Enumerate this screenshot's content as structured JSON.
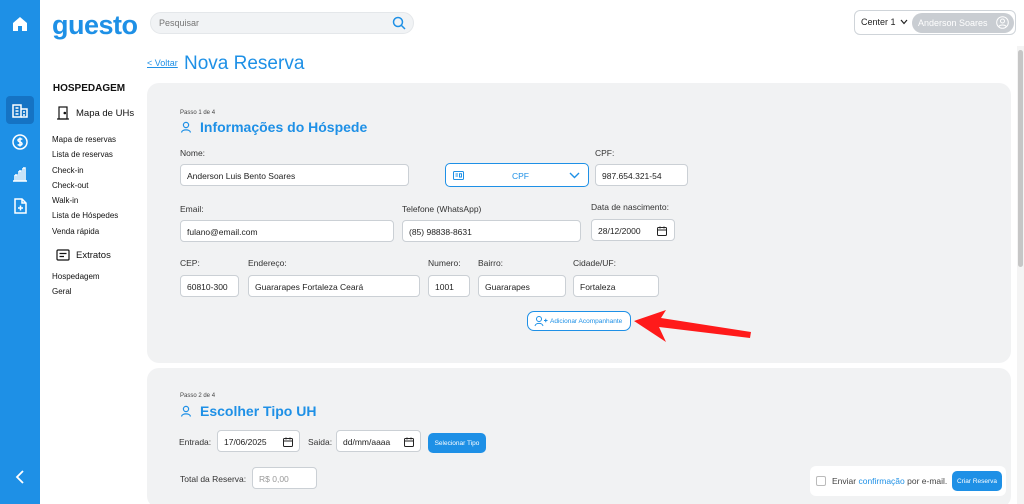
{
  "brand": {
    "logo_text": "guesto",
    "accent": "#1e90e6"
  },
  "search": {
    "placeholder": "Pesquisar"
  },
  "header": {
    "center": "Center 1",
    "user": "Anderson Soares"
  },
  "sidebar": {
    "heading": "HOSPEDAGEM",
    "group_mapa": "Mapa de UHs",
    "links": [
      "Mapa de reservas",
      "Lista de reservas",
      "Check-in",
      "Check-out",
      "Walk-in",
      "Lista de Hóspedes",
      "Venda rápida"
    ],
    "group_extratos": "Extratos",
    "extratos_links": [
      "Hospedagem",
      "Geral"
    ]
  },
  "page": {
    "back": "< Voltar",
    "title": "Nova Reserva"
  },
  "step1": {
    "step_label": "Passo 1 de 4",
    "title": "Informações do Hóspede",
    "nome_label": "Nome:",
    "nome_value": "Anderson Luis Bento Soares",
    "doc_type": "CPF",
    "cpf_label": "CPF:",
    "cpf_value": "987.654.321-54",
    "email_label": "Email:",
    "email_value": "fulano@email.com",
    "telefone_label": "Telefone (WhatsApp)",
    "telefone_value": "(85) 98838-8631",
    "nascimento_label": "Data de nascimento:",
    "nascimento_value": "28/12/2000",
    "cep_label": "CEP:",
    "cep_value": "60810-300",
    "endereco_label": "Endereço:",
    "endereco_value": "Guararapes  Fortaleza  Ceará",
    "numero_label": "Numero:",
    "numero_value": "1001",
    "bairro_label": "Bairro:",
    "bairro_value": "Guararapes",
    "cidade_label": "Cidade/UF:",
    "cidade_value": "Fortaleza",
    "add_companion": "Adicionar Acompanhante"
  },
  "step2": {
    "step_label": "Passo 2 de 4",
    "title": "Escolher Tipo UH",
    "entrada_label": "Entrada:",
    "entrada_value": "17/06/2025",
    "saida_label": "Saida:",
    "saida_value": "dd/mm/aaaa",
    "select_btn": "Selecionar Tipo",
    "total_label": "Total da Reserva:",
    "total_placeholder": "R$ 0,00"
  },
  "footer": {
    "send_prefix": "Enviar ",
    "send_link": "confirmação",
    "send_suffix": " por e-mail.",
    "create_btn": "Criar Reserva"
  },
  "annotation": {
    "arrow_color": "#ff1a1a"
  }
}
